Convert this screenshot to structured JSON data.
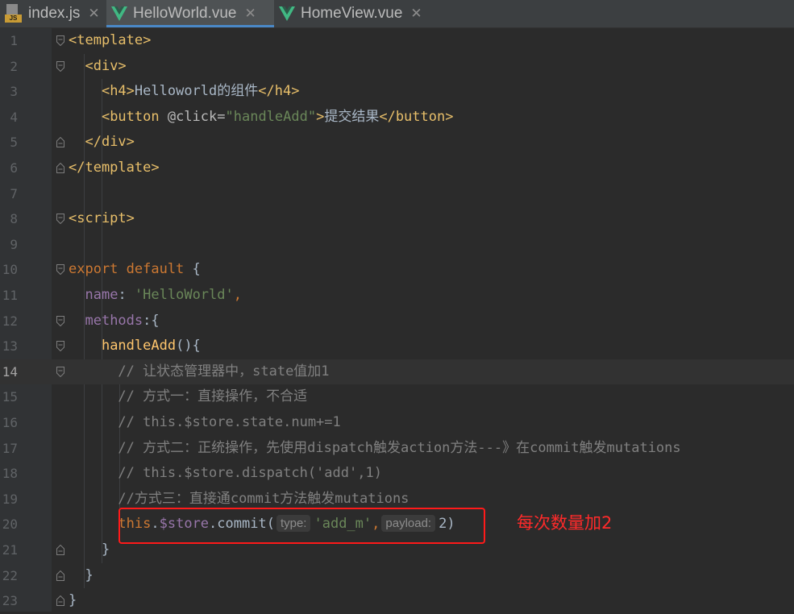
{
  "tabs": [
    {
      "label": "index.js",
      "icon": "js-file-icon",
      "active": false
    },
    {
      "label": "HelloWorld.vue",
      "icon": "vue-file-icon",
      "active": true
    },
    {
      "label": "HomeView.vue",
      "icon": "vue-file-icon",
      "active": false
    }
  ],
  "colors": {
    "tag": "#e8bf6a",
    "keyword": "#cc7832",
    "string": "#6a8759",
    "property": "#9876aa",
    "function": "#ffc66d",
    "comment": "#808080",
    "annotation": "#ff2a2a",
    "active_tab_underline": "#4a88c7"
  },
  "current_line": 14,
  "lines": [
    {
      "n": "1",
      "tokens": [
        [
          "tag",
          "<template>"
        ]
      ]
    },
    {
      "n": "2",
      "tokens": [
        [
          "plain",
          "  "
        ],
        [
          "tag",
          "<div>"
        ]
      ]
    },
    {
      "n": "3",
      "tokens": [
        [
          "plain",
          "    "
        ],
        [
          "tag",
          "<h4>"
        ],
        [
          "plain",
          "Helloworld的组件"
        ],
        [
          "tag",
          "</h4>"
        ]
      ]
    },
    {
      "n": "4",
      "tokens": [
        [
          "plain",
          "    "
        ],
        [
          "tag",
          "<button "
        ],
        [
          "attr",
          "@click="
        ],
        [
          "str",
          "\"handleAdd\""
        ],
        [
          "tag",
          ">"
        ],
        [
          "plain",
          "提交结果"
        ],
        [
          "tag",
          "</button>"
        ]
      ]
    },
    {
      "n": "5",
      "tokens": [
        [
          "plain",
          "  "
        ],
        [
          "tag",
          "</div>"
        ]
      ]
    },
    {
      "n": "6",
      "tokens": [
        [
          "tag",
          "</template>"
        ]
      ]
    },
    {
      "n": "7",
      "tokens": []
    },
    {
      "n": "8",
      "tokens": [
        [
          "tag",
          "<script>"
        ]
      ]
    },
    {
      "n": "9",
      "tokens": []
    },
    {
      "n": "10",
      "tokens": [
        [
          "kw",
          "export default "
        ],
        [
          "plain",
          "{"
        ]
      ]
    },
    {
      "n": "11",
      "tokens": [
        [
          "plain",
          "  "
        ],
        [
          "prop",
          "name"
        ],
        [
          "plain",
          ": "
        ],
        [
          "str",
          "'HelloWorld'"
        ],
        [
          "kw",
          ","
        ]
      ]
    },
    {
      "n": "12",
      "tokens": [
        [
          "plain",
          "  "
        ],
        [
          "prop",
          "methods"
        ],
        [
          "plain",
          ":{"
        ]
      ]
    },
    {
      "n": "13",
      "tokens": [
        [
          "plain",
          "    "
        ],
        [
          "fn",
          "handleAdd"
        ],
        [
          "plain",
          "(){"
        ]
      ]
    },
    {
      "n": "14",
      "tokens": [
        [
          "plain",
          "      "
        ],
        [
          "cmt",
          "// 让状态管理器中，state值加1"
        ]
      ]
    },
    {
      "n": "15",
      "tokens": [
        [
          "plain",
          "      "
        ],
        [
          "cmt",
          "// 方式一：直接操作，不合适"
        ]
      ]
    },
    {
      "n": "16",
      "tokens": [
        [
          "plain",
          "      "
        ],
        [
          "cmt",
          "// this.$store.state.num+=1"
        ]
      ]
    },
    {
      "n": "17",
      "tokens": [
        [
          "plain",
          "      "
        ],
        [
          "cmt",
          "// 方式二：正统操作，先使用dispatch触发action方法---》在commit触发mutations"
        ]
      ]
    },
    {
      "n": "18",
      "tokens": [
        [
          "plain",
          "      "
        ],
        [
          "cmt",
          "// this.$store.dispatch('add',1)"
        ]
      ]
    },
    {
      "n": "19",
      "tokens": [
        [
          "plain",
          "      "
        ],
        [
          "cmt",
          "//方式三：直接通commit方法触发mutations"
        ]
      ]
    },
    {
      "n": "20",
      "tokens": [
        [
          "plain",
          "      "
        ],
        [
          "kw",
          "this"
        ],
        [
          "plain",
          "."
        ],
        [
          "prop",
          "$store"
        ],
        [
          "plain",
          "."
        ],
        [
          "plain",
          "commit("
        ],
        [
          "hint",
          "type:"
        ],
        [
          "str",
          "'add_m'"
        ],
        [
          "kw",
          ","
        ],
        [
          "hint",
          "payload:"
        ],
        [
          "plain",
          "2)"
        ]
      ]
    },
    {
      "n": "21",
      "tokens": [
        [
          "plain",
          "    }"
        ]
      ]
    },
    {
      "n": "22",
      "tokens": [
        [
          "plain",
          "  }"
        ]
      ]
    },
    {
      "n": "23",
      "tokens": [
        [
          "plain",
          "}"
        ]
      ]
    }
  ],
  "annotation": "每次数量加2"
}
